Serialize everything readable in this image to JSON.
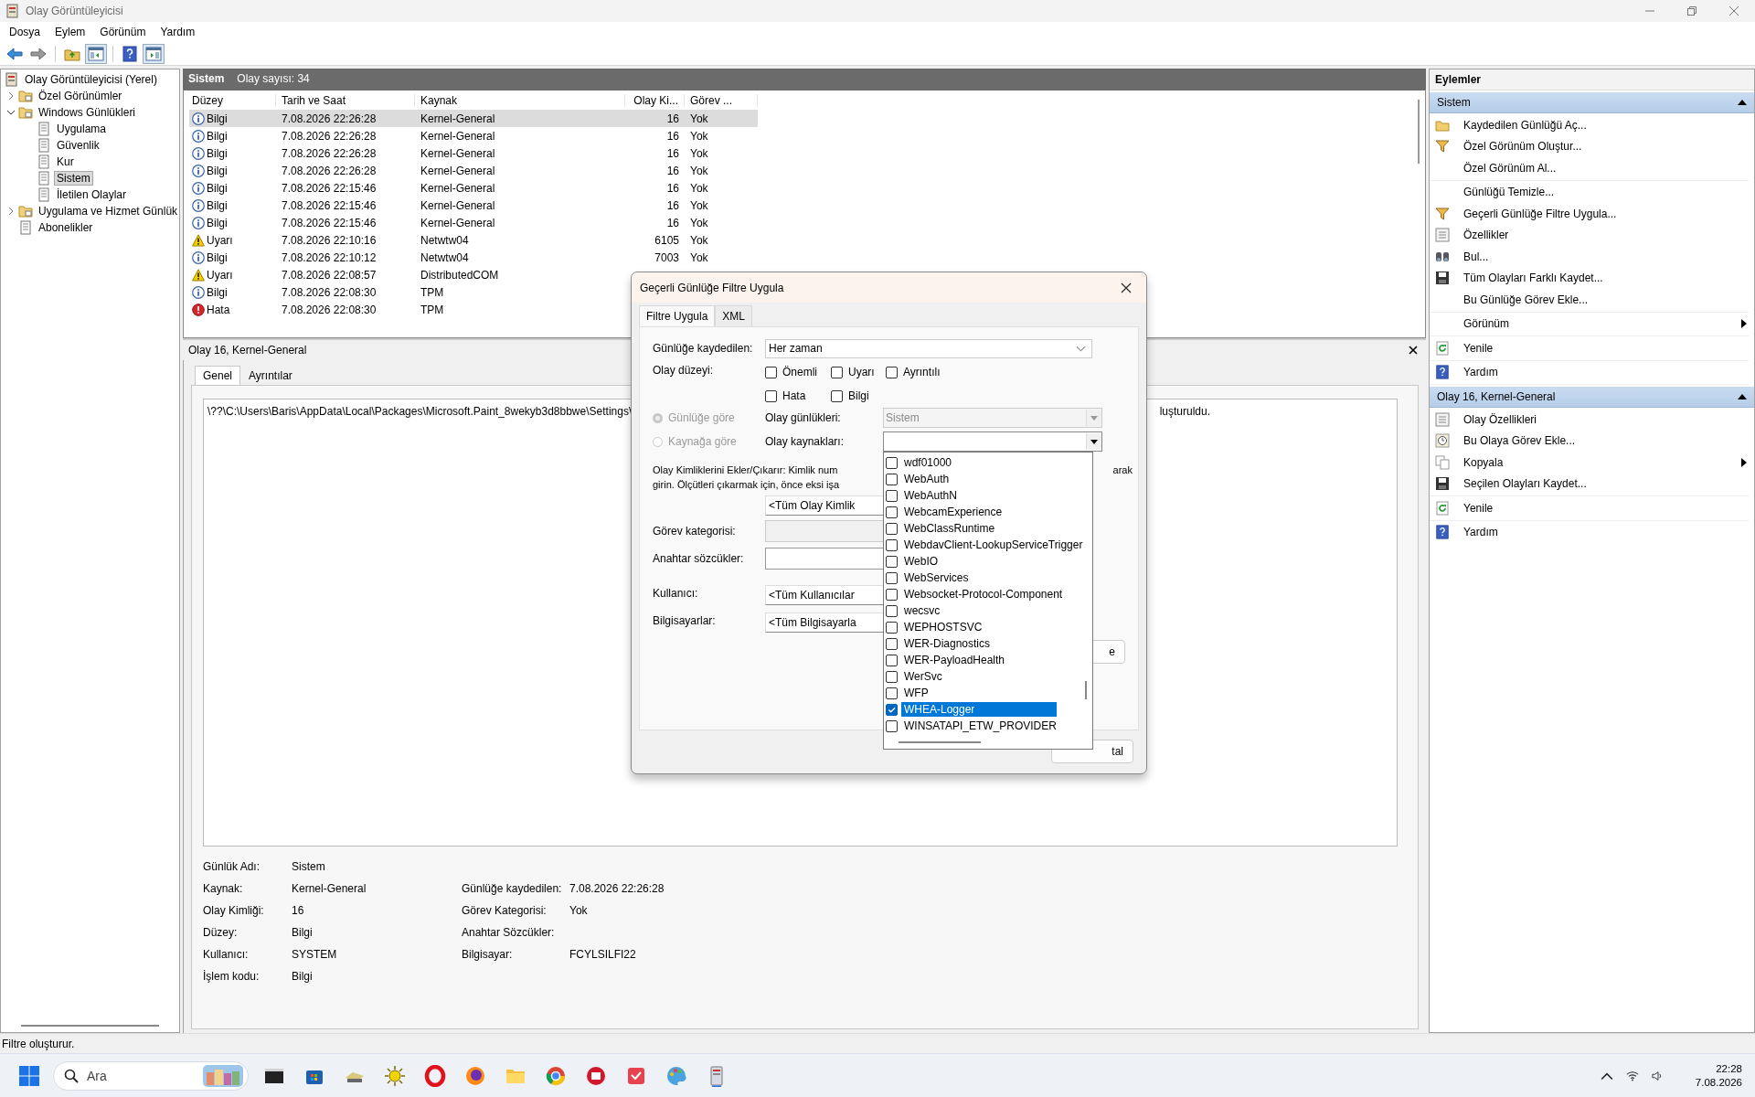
{
  "window": {
    "title": "Olay Görüntüleyicisi"
  },
  "menu": [
    "Dosya",
    "Eylem",
    "Görünüm",
    "Yardım"
  ],
  "tree": [
    {
      "label": "Olay Görüntüleyicisi (Yerel)",
      "selected": false,
      "children": [
        {
          "label": "Özel Görünümler",
          "expanded": false,
          "selected": false
        },
        {
          "label": "Windows Günlükleri",
          "expanded": true,
          "selected": false,
          "children": [
            {
              "label": "Uygulama",
              "selected": false
            },
            {
              "label": "Güvenlik",
              "selected": false
            },
            {
              "label": "Kur",
              "selected": false
            },
            {
              "label": "Sistem",
              "selected": true
            },
            {
              "label": "İletilen Olaylar",
              "selected": false
            }
          ]
        },
        {
          "label": "Uygulama ve Hizmet Günlük",
          "expanded": false,
          "selected": false
        },
        {
          "label": "Abonelikler",
          "selected": false
        }
      ]
    }
  ],
  "events": {
    "title": "Sistem",
    "count": "Olay sayısı: 34",
    "columns": [
      "Düzey",
      "Tarih ve Saat",
      "Kaynak",
      "Olay Ki...",
      "Görev ..."
    ],
    "rows": [
      {
        "kind": "info",
        "level_text": "Bilgi",
        "date": "7.08.2026 22:26:28",
        "source": "Kernel-General",
        "id": "16",
        "task": "Yok",
        "selected": true
      },
      {
        "kind": "info",
        "level_text": "Bilgi",
        "date": "7.08.2026 22:26:28",
        "source": "Kernel-General",
        "id": "16",
        "task": "Yok",
        "selected": false
      },
      {
        "kind": "info",
        "level_text": "Bilgi",
        "date": "7.08.2026 22:26:28",
        "source": "Kernel-General",
        "id": "16",
        "task": "Yok",
        "selected": false
      },
      {
        "kind": "info",
        "level_text": "Bilgi",
        "date": "7.08.2026 22:26:28",
        "source": "Kernel-General",
        "id": "16",
        "task": "Yok",
        "selected": false
      },
      {
        "kind": "info",
        "level_text": "Bilgi",
        "date": "7.08.2026 22:15:46",
        "source": "Kernel-General",
        "id": "16",
        "task": "Yok",
        "selected": false
      },
      {
        "kind": "info",
        "level_text": "Bilgi",
        "date": "7.08.2026 22:15:46",
        "source": "Kernel-General",
        "id": "16",
        "task": "Yok",
        "selected": false
      },
      {
        "kind": "info",
        "level_text": "Bilgi",
        "date": "7.08.2026 22:15:46",
        "source": "Kernel-General",
        "id": "16",
        "task": "Yok",
        "selected": false
      },
      {
        "kind": "warning",
        "level_text": "Uyarı",
        "date": "7.08.2026 22:10:16",
        "source": "Netwtw04",
        "id": "6105",
        "task": "Yok",
        "selected": false
      },
      {
        "kind": "info",
        "level_text": "Bilgi",
        "date": "7.08.2026 22:10:12",
        "source": "Netwtw04",
        "id": "7003",
        "task": "Yok",
        "selected": false
      },
      {
        "kind": "warning",
        "level_text": "Uyarı",
        "date": "7.08.2026 22:08:57",
        "source": "DistributedCOM",
        "selected": false
      },
      {
        "kind": "info",
        "level_text": "Bilgi",
        "date": "7.08.2026 22:08:30",
        "source": "TPM",
        "selected": false
      },
      {
        "kind": "error",
        "level_text": "Hata",
        "date": "7.08.2026 22:08:30",
        "source": "TPM",
        "selected": false
      }
    ]
  },
  "detail": {
    "title": "Olay 16, Kernel-General",
    "tabs": [
      {
        "label": "Genel",
        "selected": true
      },
      {
        "label": "Ayrıntılar",
        "selected": false
      }
    ],
    "description_left": "\\??\\C:\\Users\\Baris\\AppData\\Local\\Packages\\Microsoft.Paint_8wekyb3d8bbwe\\Settings\\",
    "description_right": "luşturuldu.",
    "fields": [
      {
        "label": "Günlük Adı:",
        "value": "Sistem"
      },
      {
        "label": "Kaynak:",
        "value": "Kernel-General",
        "label_2": "Günlüğe kaydedilen:",
        "value_2": "7.08.2026 22:26:28"
      },
      {
        "label": "Olay Kimliği:",
        "value": "16",
        "label_2": "Görev Kategorisi:",
        "value_2": "Yok"
      },
      {
        "label": "Düzey:",
        "value": "Bilgi",
        "label_2": "Anahtar Sözcükler:"
      },
      {
        "label": "Kullanıcı:",
        "value": "SYSTEM",
        "label_2": "Bilgisayar:",
        "value_2": "FCYLSILFI22"
      },
      {
        "label": "İşlem kodu:",
        "value": "Bilgi"
      }
    ]
  },
  "actions": {
    "title": "Eylemler",
    "sections": [
      {
        "title": "Sistem",
        "expanded": true,
        "groups": [
          [
            {
              "label": "Kaydedilen Günlüğü Aç..."
            },
            {
              "label": "Özel Görünüm Oluştur..."
            },
            {
              "label": "Özel Görünüm Al..."
            }
          ],
          [
            {
              "label": "Günlüğü Temizle..."
            },
            {
              "label": "Geçerli Günlüğe Filtre Uygula..."
            },
            {
              "label": "Özellikler"
            },
            {
              "label": "Bul..."
            },
            {
              "label": "Tüm Olayları Farklı Kaydet..."
            },
            {
              "label": "Bu Günlüğe Görev Ekle..."
            }
          ],
          [
            {
              "label": "Görünüm",
              "submenu": true
            }
          ],
          [
            {
              "label": "Yenile"
            }
          ],
          [
            {
              "label": "Yardım"
            }
          ]
        ]
      },
      {
        "title": "Olay 16, Kernel-General",
        "expanded": true,
        "groups": [
          [
            {
              "label": "Olay Özellikleri"
            },
            {
              "label": "Bu Olaya Görev Ekle..."
            },
            {
              "label": "Kopyala",
              "submenu": true
            },
            {
              "label": "Seçilen Olayları Kaydet..."
            }
          ],
          [
            {
              "label": "Yenile"
            }
          ],
          [
            {
              "label": "Yardım"
            }
          ]
        ]
      }
    ]
  },
  "dialog": {
    "title": "Geçerli Günlüğe Filtre Uygula",
    "tabs": [
      {
        "label": "Filtre Uygula",
        "selected": true
      },
      {
        "label": "XML",
        "selected": false
      }
    ],
    "logged": {
      "label": "Günlüğe kaydedilen:",
      "value": "Her zaman"
    },
    "event_level": {
      "label": "Olay düzeyi:",
      "options": [
        {
          "label": "Önemli",
          "checked": false
        },
        {
          "label": "Uyarı",
          "checked": false
        },
        {
          "label": "Ayrıntılı",
          "checked": false
        },
        {
          "label": "Hata",
          "checked": false
        },
        {
          "label": "Bilgi",
          "checked": false
        }
      ]
    },
    "scope": [
      {
        "label": "Günlüğe göre",
        "selected": true,
        "disabled": true,
        "field_label": "Olay günlükleri:",
        "value": "Sistem",
        "field_disabled": true
      },
      {
        "label": "Kaynağa göre",
        "selected": false,
        "disabled": true,
        "field_label": "Olay kaynakları:",
        "field_disabled": false,
        "expanded": true
      }
    ],
    "sources": [
      {
        "label": "wdf01000",
        "checked": false,
        "selected": false
      },
      {
        "label": "WebAuth",
        "checked": false,
        "selected": false
      },
      {
        "label": "WebAuthN",
        "checked": false,
        "selected": false
      },
      {
        "label": "WebcamExperience",
        "checked": false,
        "selected": false
      },
      {
        "label": "WebClassRuntime",
        "checked": false,
        "selected": false
      },
      {
        "label": "WebdavClient-LookupServiceTrigger",
        "checked": false,
        "selected": false
      },
      {
        "label": "WebIO",
        "checked": false,
        "selected": false
      },
      {
        "label": "WebServices",
        "checked": false,
        "selected": false
      },
      {
        "label": "Websocket-Protocol-Component",
        "checked": false,
        "selected": false
      },
      {
        "label": "wecsvc",
        "checked": false,
        "selected": false
      },
      {
        "label": "WEPHOSTSVC",
        "checked": false,
        "selected": false
      },
      {
        "label": "WER-Diagnostics",
        "checked": false,
        "selected": false
      },
      {
        "label": "WER-PayloadHealth",
        "checked": false,
        "selected": false
      },
      {
        "label": "WerSvc",
        "checked": false,
        "selected": false
      },
      {
        "label": "WFP",
        "checked": false,
        "selected": false
      },
      {
        "label": "WHEA-Logger",
        "checked": true,
        "selected": true
      },
      {
        "label": "WINSATAPI_ETW_PROVIDER",
        "checked": false,
        "selected": false
      }
    ],
    "help_lines": [
      {
        "left": "Olay Kimliklerini Ekler/Çıkarır: Kimlik num",
        "right": "arak"
      },
      {
        "left": "girin. Ölçütleri çıkarmak için, önce eksi işa"
      }
    ],
    "ids_value": "<Tüm Olay Kimlik",
    "task_category": {
      "label": "Görev kategorisi:",
      "disabled": true
    },
    "keywords": {
      "label": "Anahtar sözcükler:"
    },
    "user": {
      "label": "Kullanıcı:",
      "value": "<Tüm Kullanıcılar"
    },
    "computers": {
      "label": "Bilgisayarlar:",
      "value": "<Tüm Bilgisayarla"
    },
    "clear_button": "e",
    "cancel_button": "tal"
  },
  "status_bar": "Filtre oluşturur.",
  "taskbar": {
    "search_placeholder": "Ara",
    "time": "22:28",
    "date": "7.08.2026"
  }
}
